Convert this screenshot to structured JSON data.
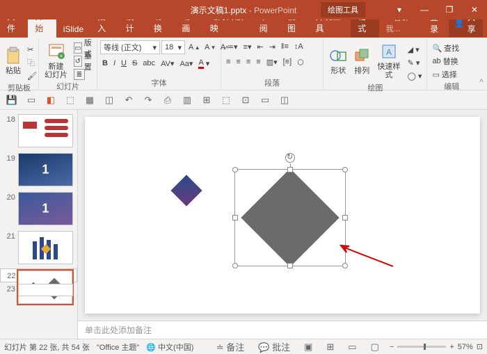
{
  "title": {
    "doc": "演示文稿1.pptx",
    "app": "PowerPoint",
    "context": "绘图工具"
  },
  "win": {
    "restore": "❐",
    "min": "—",
    "max": "□",
    "close": "✕"
  },
  "tabs": {
    "file": "文件",
    "home": "开始",
    "islide": "iSlide",
    "insert": "插入",
    "design": "设计",
    "transitions": "切换",
    "animations": "动画",
    "slideshow": "幻灯片放映",
    "review": "审阅",
    "view": "视图",
    "developer": "开发工具",
    "format": "格式",
    "tell": "告诉我...",
    "signin": "登录",
    "share": "共享"
  },
  "ribbon": {
    "clipboard": {
      "paste": "粘贴",
      "label": "剪贴板"
    },
    "slides": {
      "new": "新建\n幻灯片",
      "layout": "版式",
      "reset": "重置",
      "label": "幻灯片"
    },
    "font": {
      "name": "等线 (正文)",
      "size": "18",
      "label": "字体"
    },
    "para": {
      "label": "段落"
    },
    "drawing": {
      "shapes": "形状",
      "arrange": "排列",
      "quick": "快速样式",
      "label": "绘图"
    },
    "editing": {
      "find": "查找",
      "replace": "替换",
      "select": "选择",
      "label": "编辑"
    }
  },
  "thumbs": [
    {
      "n": "18"
    },
    {
      "n": "19"
    },
    {
      "n": "20"
    },
    {
      "n": "21"
    },
    {
      "n": "22"
    },
    {
      "n": "23"
    }
  ],
  "notes_placeholder": "单击此处添加备注",
  "status": {
    "slide": "幻灯片 第 22 张, 共 54 张",
    "theme": "\"Office 主题\"",
    "lang": "中文(中国)",
    "notes": "备注",
    "comments": "批注",
    "zoom": "57%"
  }
}
